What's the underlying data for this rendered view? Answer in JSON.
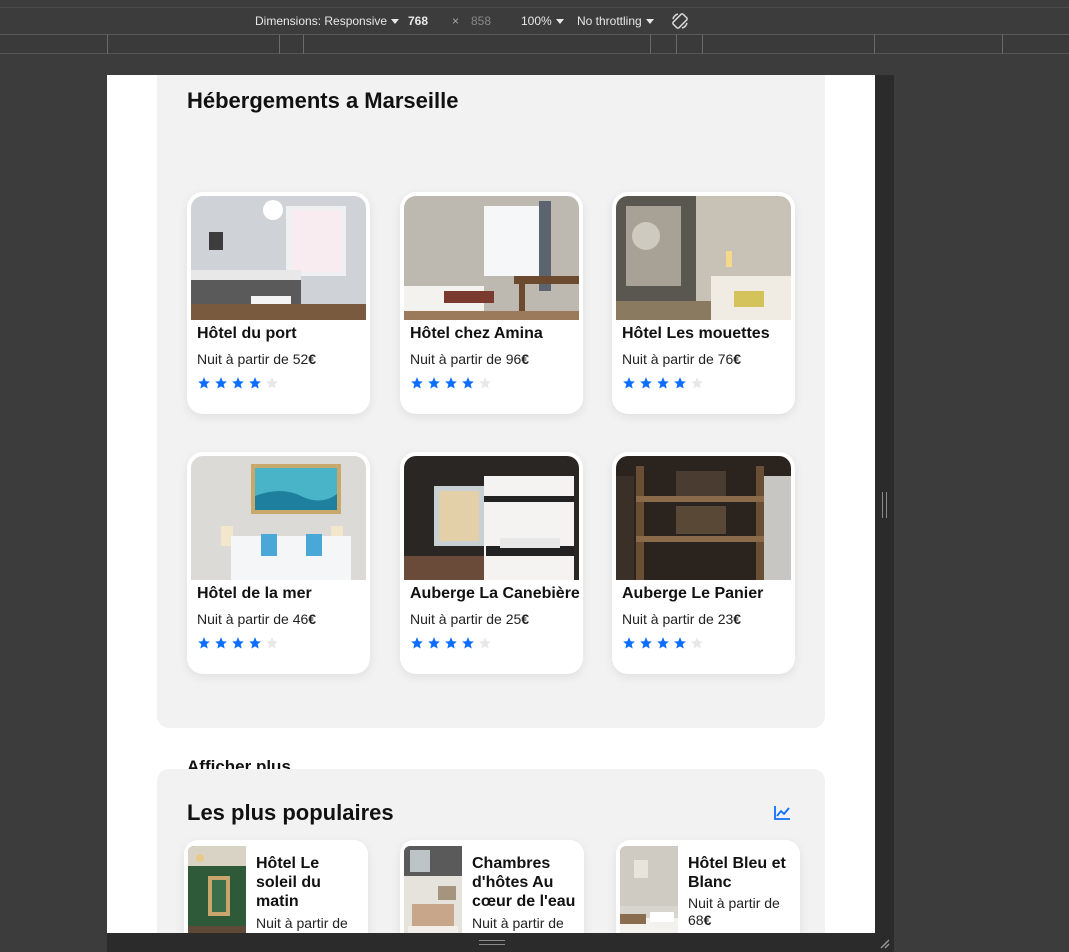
{
  "devtools": {
    "dimensions_label": "Dimensions: Responsive",
    "width": "768",
    "times": "×",
    "height": "858",
    "zoom": "100%",
    "throttling": "No throttling"
  },
  "lodging": {
    "title": "Hébergements a Marseille",
    "cards": [
      {
        "name": "Hôtel du port",
        "price_prefix": "Nuit à partir de ",
        "price": "52",
        "currency": "€",
        "rating": 4
      },
      {
        "name": "Hôtel chez Amina",
        "price_prefix": "Nuit à partir de ",
        "price": "96",
        "currency": "€",
        "rating": 4
      },
      {
        "name": "Hôtel Les mouettes",
        "price_prefix": "Nuit à partir de ",
        "price": "76",
        "currency": "€",
        "rating": 4
      },
      {
        "name": "Hôtel de la mer",
        "price_prefix": "Nuit à partir de ",
        "price": "46",
        "currency": "€",
        "rating": 4
      },
      {
        "name": "Auberge La Canebière",
        "price_prefix": "Nuit à partir de ",
        "price": "25",
        "currency": "€",
        "rating": 4
      },
      {
        "name": "Auberge Le Panier",
        "price_prefix": "Nuit à partir de ",
        "price": "23",
        "currency": "€",
        "rating": 4
      }
    ],
    "show_more": "Afficher plus"
  },
  "popular": {
    "title": "Les plus populaires",
    "icon": "trending-up-icon",
    "cards": [
      {
        "name": "Hôtel Le soleil du matin",
        "price_text": "Nuit à partir de"
      },
      {
        "name": "Chambres d'hôtes Au cœur de l'eau",
        "price_text": "Nuit à partir de"
      },
      {
        "name": "Hôtel Bleu et Blanc",
        "price_text": "Nuit à partir de",
        "price": "68",
        "currency": "€"
      }
    ]
  },
  "colors": {
    "star_filled": "#0d6efd",
    "star_empty": "#e8e8e8",
    "accent": "#0d6efd"
  }
}
